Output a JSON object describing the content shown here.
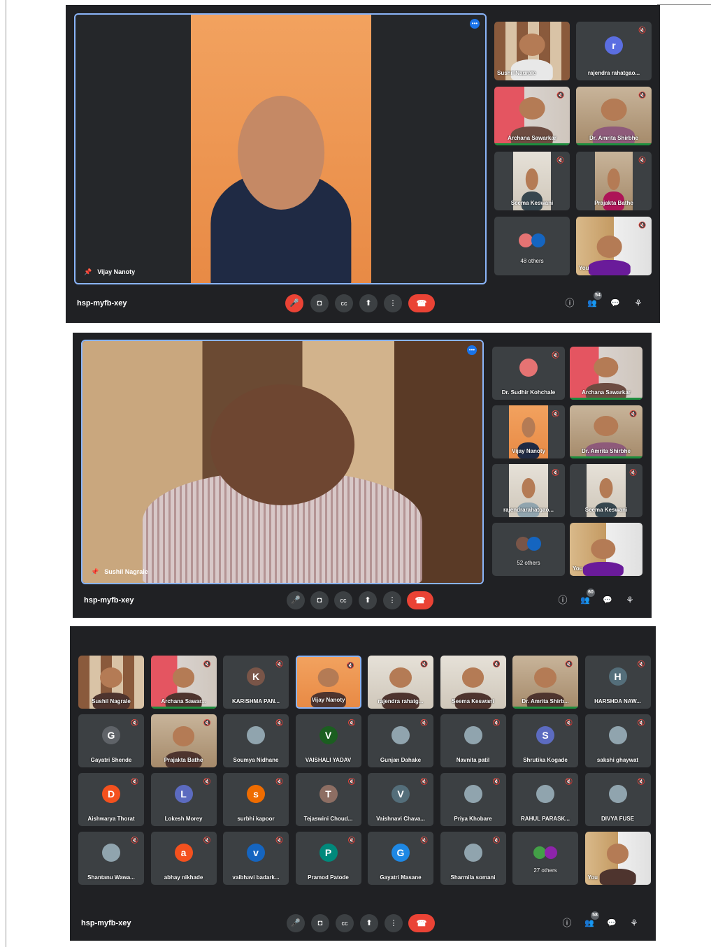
{
  "meeting_code": "hsp-myfb-xey",
  "shot1": {
    "speaker": "Vijay Nanoty",
    "tiles": [
      {
        "name": "Sushil Nagrale"
      },
      {
        "name": "rajendra rahatgao...",
        "initial": "r",
        "color": "#5b6ee1"
      },
      {
        "name": "Archana Sawarkar"
      },
      {
        "name": "Dr. Amrita Shirbhe"
      },
      {
        "name": "Seema Keswani"
      },
      {
        "name": "Prajakta Bathe"
      },
      {
        "name": "48 others"
      },
      {
        "name": "You"
      }
    ],
    "people_count": "54"
  },
  "shot2": {
    "speaker": "Sushil Nagrale",
    "tiles": [
      {
        "name": "Dr. Sudhir Kohchale"
      },
      {
        "name": "Archana Sawarkar"
      },
      {
        "name": "Vijay Nanoty"
      },
      {
        "name": "Dr. Amrita Shirbhe"
      },
      {
        "name": "rajendrarahatgao..."
      },
      {
        "name": "Seema Keswani"
      },
      {
        "name": "52 others"
      },
      {
        "name": "You"
      }
    ],
    "people_count": "60"
  },
  "shot3": {
    "tiles": [
      {
        "name": "Sushil Nagrale"
      },
      {
        "name": "Archana Sawar..."
      },
      {
        "name": "KARISHMA PAN...",
        "initial": "K",
        "color": "#795548"
      },
      {
        "name": "Vijay Nanoty"
      },
      {
        "name": "rajendra rahatg..."
      },
      {
        "name": "Seema Keswani"
      },
      {
        "name": "Dr. Amrita Shirb..."
      },
      {
        "name": "HARSHDA NAW...",
        "initial": "H",
        "color": "#546e7a"
      },
      {
        "name": "Gayatri Shende",
        "initial": "G",
        "color": "#5f6368"
      },
      {
        "name": "Prajakta Bathe"
      },
      {
        "name": "Soumya Nidhane"
      },
      {
        "name": "VAISHALI YADAV",
        "initial": "V",
        "color": "#1b5e20"
      },
      {
        "name": "Gunjan Dahake"
      },
      {
        "name": "Navnita patil"
      },
      {
        "name": "Shrutika Kogade",
        "initial": "S",
        "color": "#5c6bc0"
      },
      {
        "name": "sakshi ghaywat"
      },
      {
        "name": "Aishwarya Thorat",
        "initial": "D",
        "color": "#f4511e"
      },
      {
        "name": "Lokesh Morey",
        "initial": "L",
        "color": "#5c6bc0"
      },
      {
        "name": "surbhi kapoor",
        "initial": "s",
        "color": "#ef6c00"
      },
      {
        "name": "Tejaswini Choud...",
        "initial": "T",
        "color": "#8d6e63"
      },
      {
        "name": "Vaishnavi Chava...",
        "initial": "V",
        "color": "#546e7a"
      },
      {
        "name": "Priya Khobare"
      },
      {
        "name": "RAHUL PARASK..."
      },
      {
        "name": "DIVYA FUSE"
      },
      {
        "name": "Shantanu Wawa..."
      },
      {
        "name": "abhay nikhade",
        "initial": "a",
        "color": "#f4511e"
      },
      {
        "name": "vaibhavi badark...",
        "initial": "v",
        "color": "#1565c0"
      },
      {
        "name": "Pramod Patode",
        "initial": "P",
        "color": "#00897b"
      },
      {
        "name": "Gayatri Masane",
        "initial": "G",
        "color": "#1e88e5"
      },
      {
        "name": "Sharmila somani"
      },
      {
        "name": "27 others"
      },
      {
        "name": "You"
      }
    ],
    "people_count": "58"
  },
  "icons": {
    "mic": "🎤",
    "camera": "◘",
    "captions": "cc",
    "present": "⬆",
    "more": "⋮",
    "end": "☎",
    "info": "ⓘ",
    "people": "👥",
    "chat": "💬",
    "activities": "⚘",
    "pin": "📌",
    "muted": "🔇"
  }
}
